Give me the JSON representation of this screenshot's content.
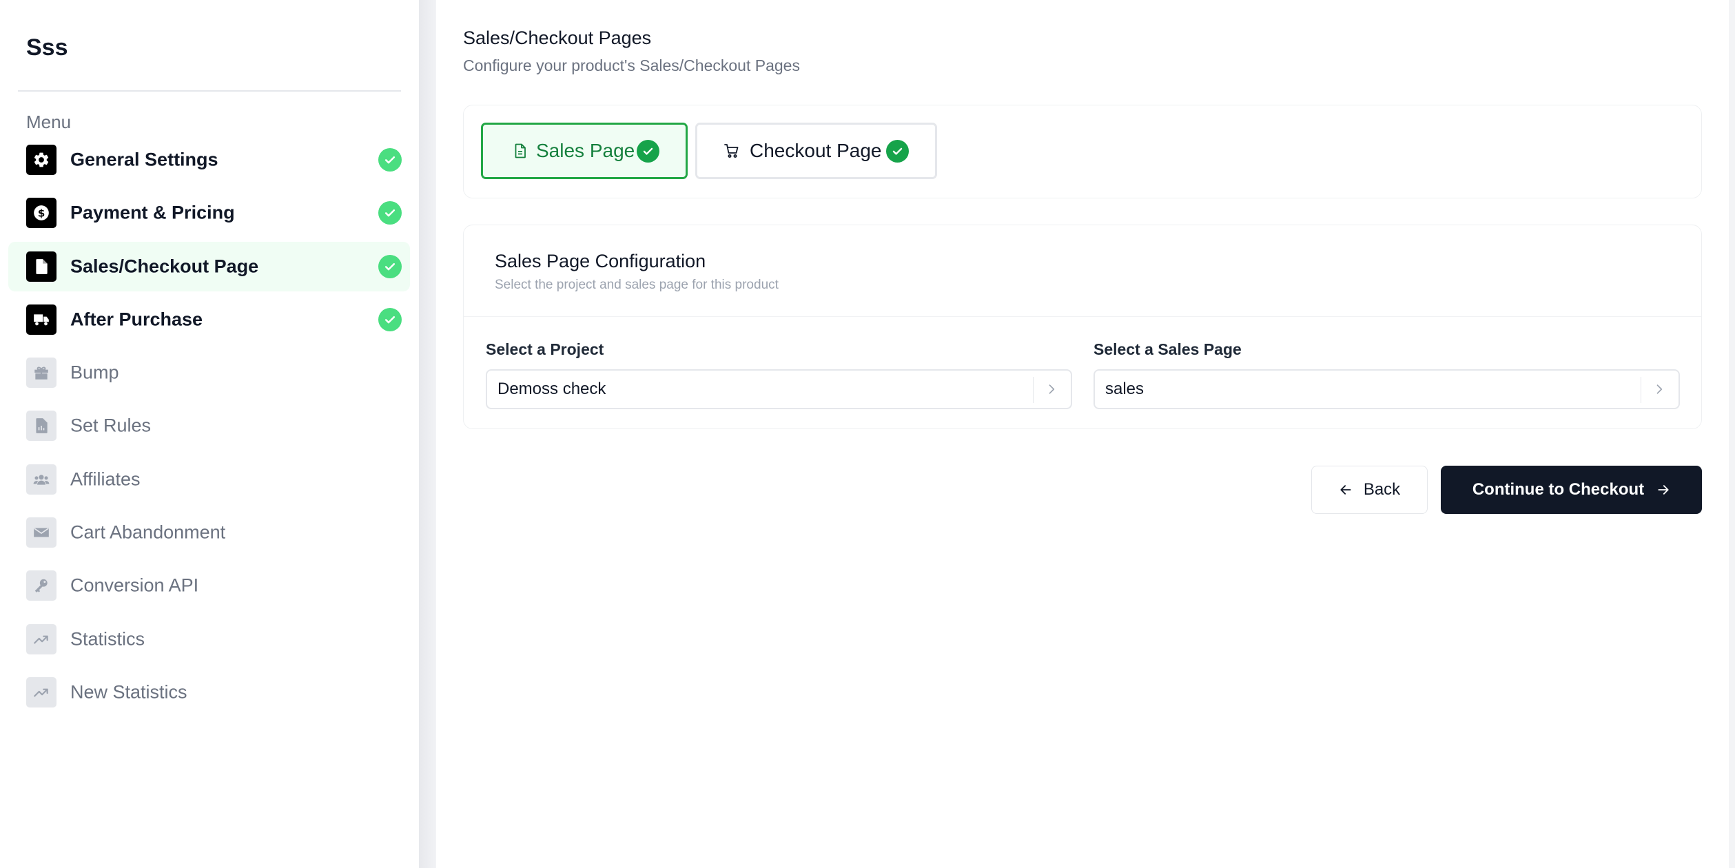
{
  "sidebar": {
    "app_title": "Sss",
    "menu_label": "Menu",
    "items": [
      {
        "label": "General Settings",
        "icon": "gear-icon",
        "status": "done",
        "active": false
      },
      {
        "label": "Payment & Pricing",
        "icon": "dollar-icon",
        "status": "done",
        "active": false
      },
      {
        "label": "Sales/Checkout Page",
        "icon": "file-icon",
        "status": "done",
        "active": true
      },
      {
        "label": "After Purchase",
        "icon": "truck-icon",
        "status": "done",
        "active": false
      },
      {
        "label": "Bump",
        "icon": "gift-icon",
        "status": "pending",
        "active": false
      },
      {
        "label": "Set Rules",
        "icon": "file-chart-icon",
        "status": "pending",
        "active": false
      },
      {
        "label": "Affiliates",
        "icon": "users-icon",
        "status": "pending",
        "active": false
      },
      {
        "label": "Cart Abandonment",
        "icon": "envelope-icon",
        "status": "pending",
        "active": false
      },
      {
        "label": "Conversion API",
        "icon": "key-icon",
        "status": "pending",
        "active": false
      },
      {
        "label": "Statistics",
        "icon": "trend-up-icon",
        "status": "pending",
        "active": false
      },
      {
        "label": "New Statistics",
        "icon": "trend-up-icon",
        "status": "pending",
        "active": false
      }
    ]
  },
  "main": {
    "title": "Sales/Checkout Pages",
    "subtitle": "Configure your product's Sales/Checkout Pages",
    "tabs": [
      {
        "label": "Sales Page",
        "icon": "file-icon",
        "selected": true,
        "completed": true
      },
      {
        "label": "Checkout Page",
        "icon": "cart-icon",
        "selected": false,
        "completed": true
      }
    ],
    "config": {
      "title": "Sales Page Configuration",
      "description": "Select the project and sales page for this product",
      "project_label": "Select a Project",
      "project_value": "Demoss check",
      "salespage_label": "Select a Sales Page",
      "salespage_value": "sales"
    },
    "buttons": {
      "back_label": "Back",
      "continue_label": "Continue to Checkout"
    }
  },
  "colors": {
    "accent_green": "#16a34a",
    "check_green": "#4ade80",
    "active_bg": "#f0fdf4",
    "primary_button": "#111827"
  }
}
